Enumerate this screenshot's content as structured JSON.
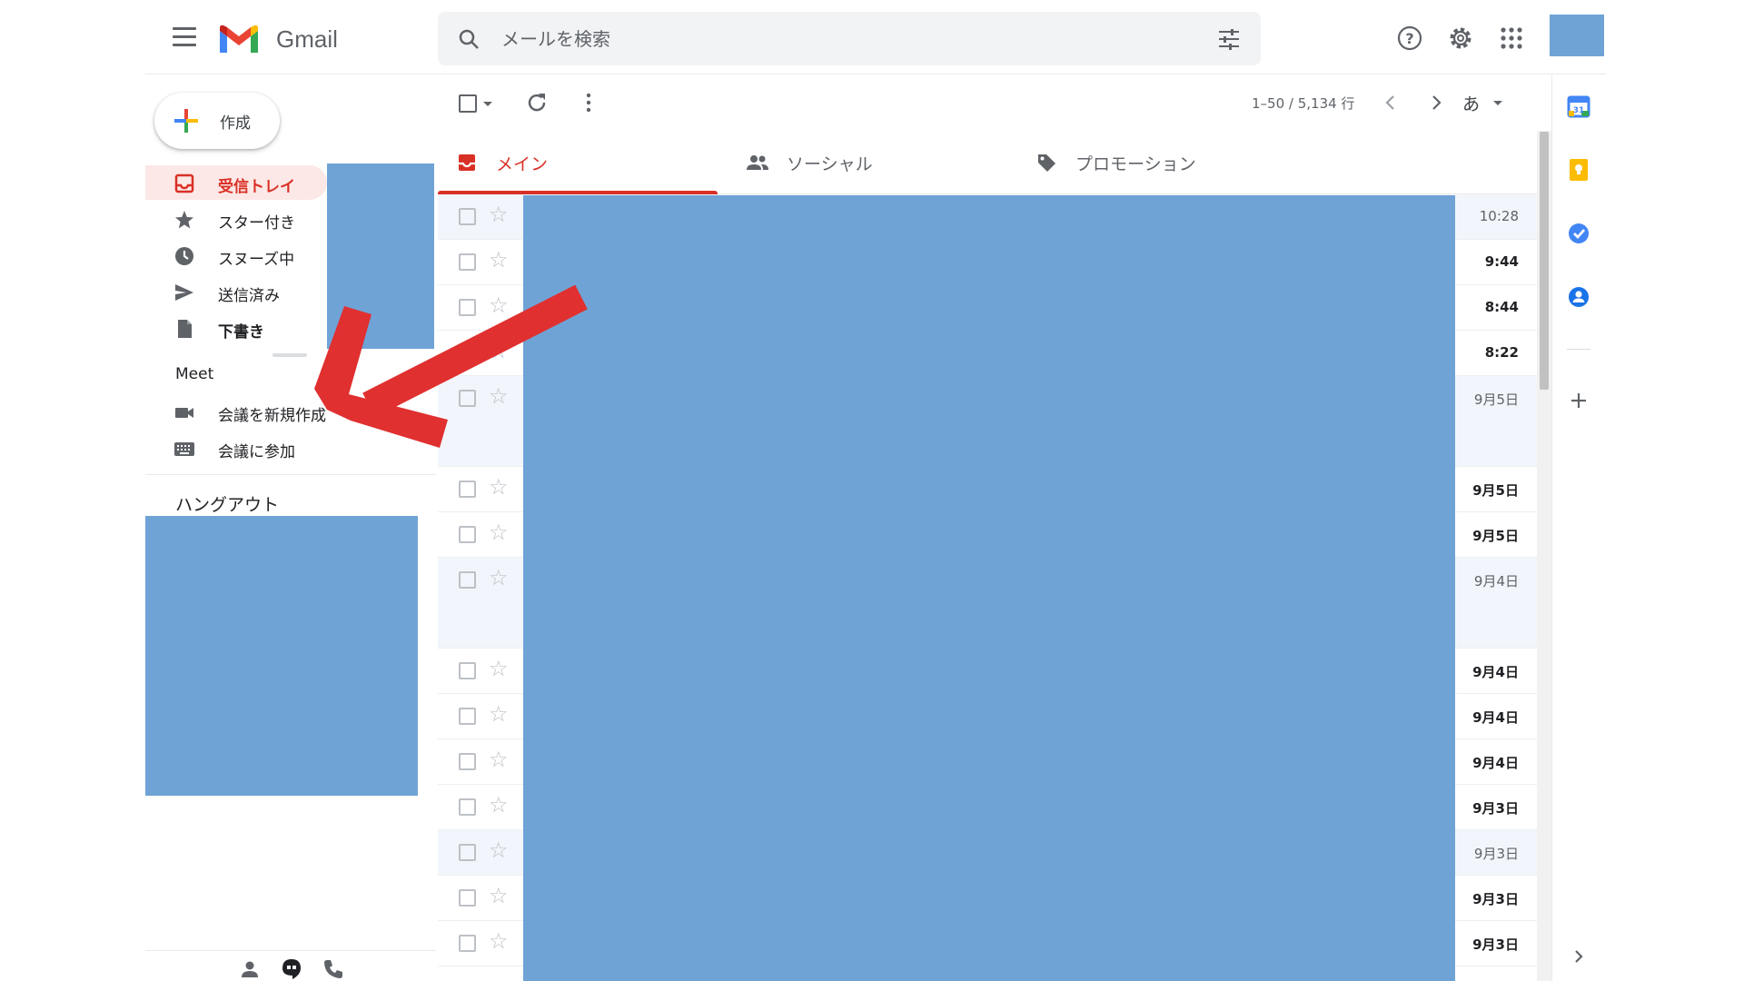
{
  "app": {
    "logo_text": "Gmail"
  },
  "search": {
    "placeholder": "メールを検索"
  },
  "compose": {
    "label": "作成"
  },
  "nav": [
    {
      "label": "受信トレイ",
      "icon": "inbox-icon"
    },
    {
      "label": "スター付き",
      "icon": "star-icon"
    },
    {
      "label": "スヌーズ中",
      "icon": "clock-icon"
    },
    {
      "label": "送信済み",
      "icon": "send-icon"
    },
    {
      "label": "下書き",
      "icon": "draft-icon"
    }
  ],
  "meet": {
    "title": "Meet",
    "items": [
      {
        "label": "会議を新規作成",
        "icon": "video-icon"
      },
      {
        "label": "会議に参加",
        "icon": "keyboard-icon"
      }
    ]
  },
  "hangouts": {
    "title": "ハングアウト"
  },
  "toolbar": {
    "pager": "1–50 / 5,134 行",
    "lang": "あ"
  },
  "tabs": [
    {
      "label": "メイン",
      "icon": "inbox-icon"
    },
    {
      "label": "ソーシャル",
      "icon": "people-icon"
    },
    {
      "label": "プロモーション",
      "icon": "tag-icon"
    }
  ],
  "rows": [
    {
      "time": "10:28",
      "read": true
    },
    {
      "time": "9:44",
      "read": false
    },
    {
      "time": "8:44",
      "read": false
    },
    {
      "time": "8:22",
      "read": false
    },
    {
      "time": "9月5日",
      "read": true
    },
    {
      "time": "9月5日",
      "read": false
    },
    {
      "time": "9月5日",
      "read": false
    },
    {
      "time": "9月4日",
      "read": true
    },
    {
      "time": "9月4日",
      "read": false
    },
    {
      "time": "9月4日",
      "read": false
    },
    {
      "time": "9月4日",
      "read": false
    },
    {
      "time": "9月3日",
      "read": false
    },
    {
      "time": "9月3日",
      "read": true
    },
    {
      "time": "9月3日",
      "read": false
    },
    {
      "time": "9月3日",
      "read": false
    }
  ],
  "colors": {
    "accent": "#d93025",
    "redacted": "#6fa3d6",
    "arrow": "#e03030"
  }
}
